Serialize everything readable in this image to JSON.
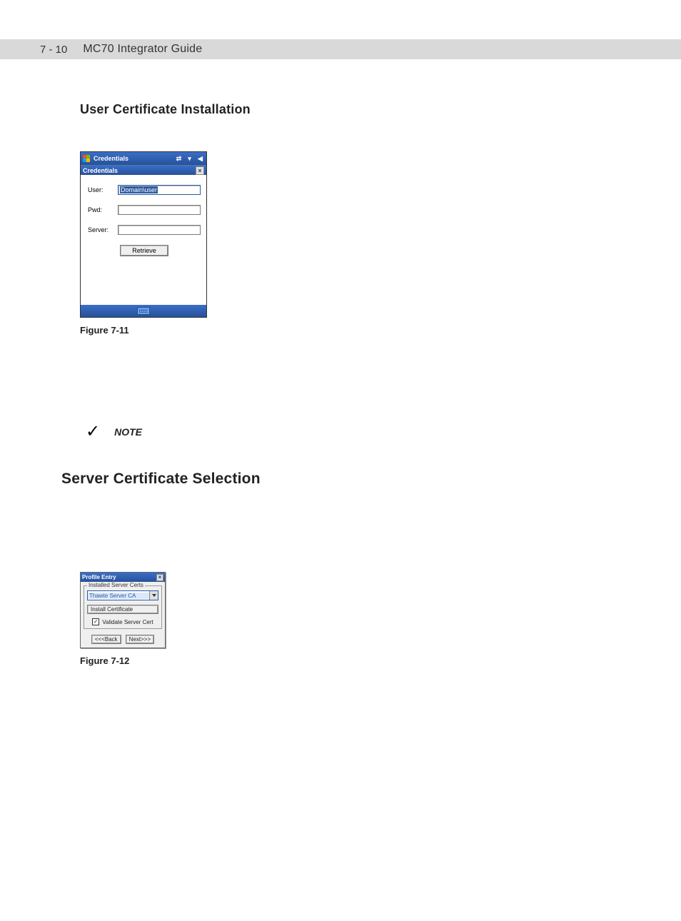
{
  "page": {
    "number": "7 - 10",
    "guide_title": "MC70 Integrator Guide"
  },
  "section1": {
    "heading": "User Certificate Installation"
  },
  "fig711": {
    "titlebar": "Credentials",
    "toolbar": "Credentials",
    "fields": {
      "user_label": "User:",
      "user_value": "Domain\\user",
      "pwd_label": "Pwd:",
      "pwd_value": "",
      "server_label": "Server:",
      "server_value": ""
    },
    "retrieve_label": "Retrieve",
    "caption": "Figure 7-11"
  },
  "note": {
    "label": "NOTE"
  },
  "section2": {
    "heading": "Server Certificate Selection"
  },
  "fig712": {
    "title": "Profile Entry",
    "frame_legend": "Installed Server Certs",
    "combo_value": "Thawte Server CA",
    "install_label": "Install Certificate",
    "checkbox_label": "Validate Server Cert",
    "checkbox_checked": "✓",
    "back_label": "<<<Back",
    "next_label": "Next>>>",
    "caption": "Figure 7-12"
  }
}
